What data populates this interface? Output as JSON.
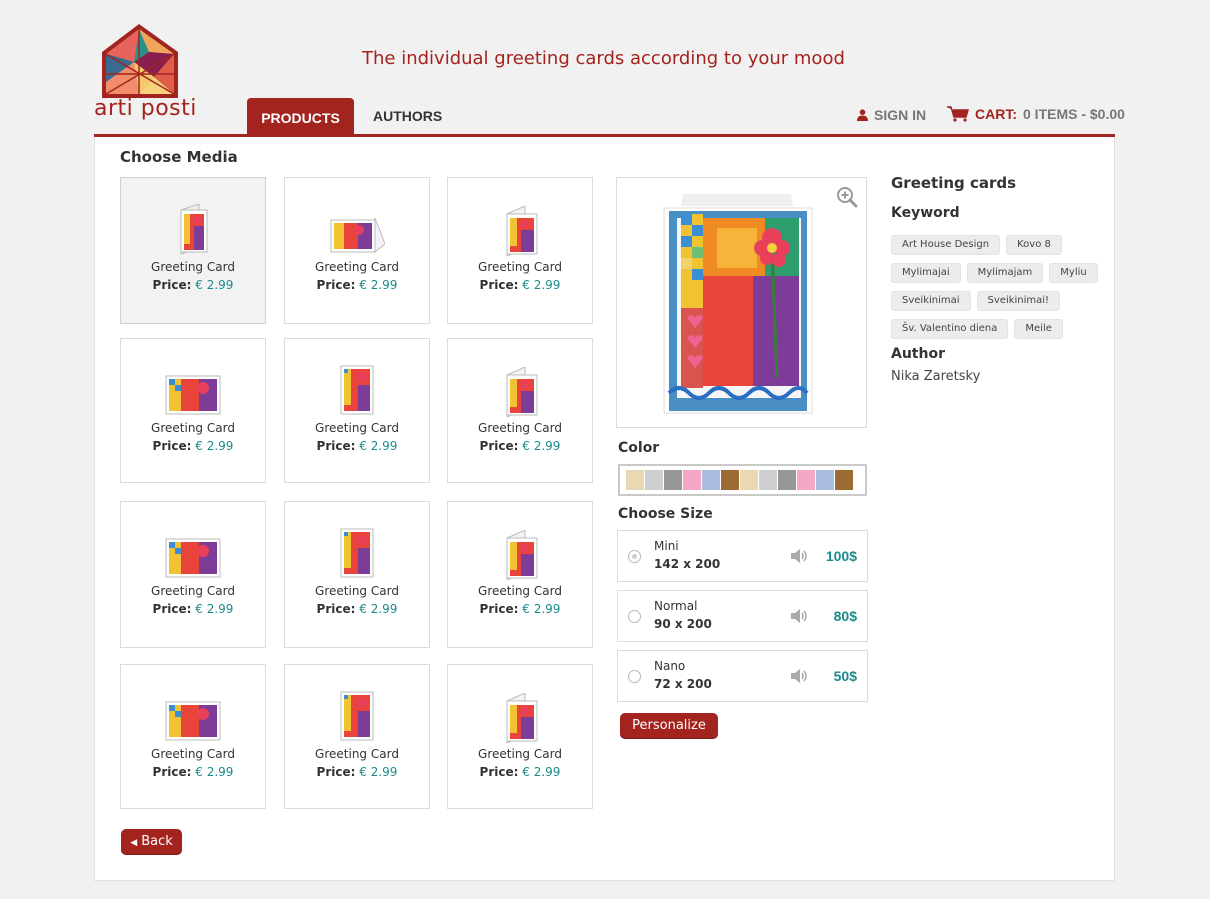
{
  "brand": {
    "name": "arti posti",
    "tagline": "The individual greeting cards according to your mood"
  },
  "nav": {
    "products": "PRODUCTS",
    "authors": "AUTHORS",
    "sign_in": "SIGN IN",
    "cart_label": "CART:",
    "cart_info": "0 ITEMS - $0.00"
  },
  "media": {
    "heading": "Choose Media",
    "price_label": "Price:",
    "items": [
      {
        "name": "Greeting Card",
        "price": "€ 2.99",
        "icon": "folded-card-portrait-icon",
        "selected": true
      },
      {
        "name": "Greeting Card",
        "price": "€ 2.99",
        "icon": "folded-card-landscape-icon"
      },
      {
        "name": "Greeting Card",
        "price": "€ 2.99",
        "icon": "folded-card-standing-icon"
      },
      {
        "name": "Greeting Card",
        "price": "€ 2.99",
        "icon": "flat-card-landscape-icon"
      },
      {
        "name": "Greeting Card",
        "price": "€ 2.99",
        "icon": "flat-card-portrait-icon"
      },
      {
        "name": "Greeting Card",
        "price": "€ 2.99",
        "icon": "folded-card-standing-icon"
      },
      {
        "name": "Greeting Card",
        "price": "€ 2.99",
        "icon": "flat-card-landscape-icon"
      },
      {
        "name": "Greeting Card",
        "price": "€ 2.99",
        "icon": "flat-card-portrait-icon"
      },
      {
        "name": "Greeting Card",
        "price": "€ 2.99",
        "icon": "folded-card-standing-icon"
      },
      {
        "name": "Greeting Card",
        "price": "€ 2.99",
        "icon": "flat-card-landscape-icon"
      },
      {
        "name": "Greeting Card",
        "price": "€ 2.99",
        "icon": "flat-card-portrait-icon"
      },
      {
        "name": "Greeting Card",
        "price": "€ 2.99",
        "icon": "folded-card-standing-icon"
      }
    ]
  },
  "color": {
    "label": "Color",
    "swatches": [
      "#e9d8b1",
      "#cfcfcf",
      "#979797",
      "#f4a8c6",
      "#a9bde0",
      "#9c6b33",
      "#e9d8b1",
      "#cfcfcf",
      "#979797",
      "#f4a8c6",
      "#a9bde0",
      "#9c6b33"
    ]
  },
  "size": {
    "label": "Choose Size",
    "options": [
      {
        "name": "Mini",
        "dims": "142 x 200",
        "price": "100$",
        "selected": true
      },
      {
        "name": "Normal",
        "dims": "90 x 200",
        "price": "80$"
      },
      {
        "name": "Nano",
        "dims": "72 x 200",
        "price": "50$"
      }
    ]
  },
  "actions": {
    "personalize": "Personalize",
    "back": "Back"
  },
  "info": {
    "title": "Greeting cards",
    "keyword_label": "Keyword",
    "keywords": [
      "Art House Design",
      "Kovo 8",
      "Mylimajai",
      "Mylimajam",
      "Myliu",
      "Sveikinimai",
      "Sveikinimai!",
      "Šv. Valentino diena",
      "Meile"
    ],
    "author_label": "Author",
    "author": "Nika Zaretsky"
  },
  "colors": {
    "brand_red": "#a3231f",
    "price_teal": "#1a8b8b"
  }
}
